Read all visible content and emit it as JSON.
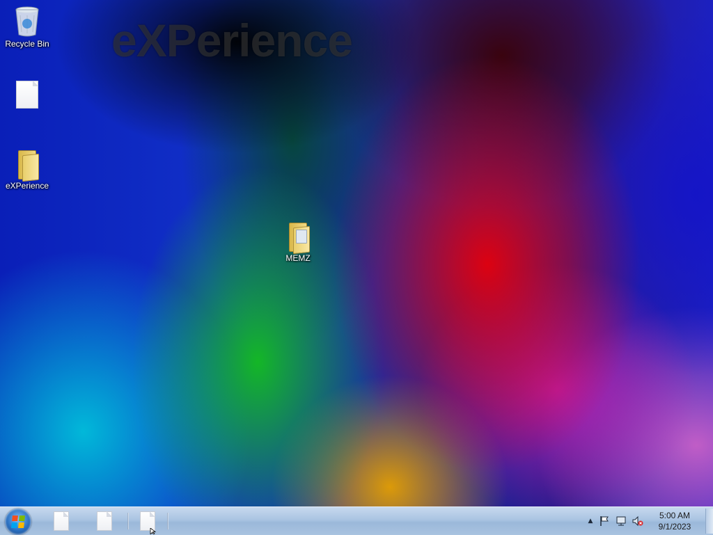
{
  "desktop": {
    "watermark": "eXPerience",
    "icons": [
      {
        "label": "Recycle Bin",
        "icon": "recycle-bin-icon"
      },
      {
        "label": "",
        "icon": "blank-document-icon"
      },
      {
        "label": "eXPerience",
        "icon": "folder-icon"
      },
      {
        "label": "MEMZ",
        "icon": "folder-icon"
      }
    ]
  },
  "taskbar": {
    "start": {
      "icon": "windows-start-icon"
    },
    "pinned": [
      {
        "icon": "blank-document-icon"
      },
      {
        "icon": "blank-document-icon"
      },
      {
        "icon": "blank-document-icon"
      }
    ],
    "tray": {
      "icons": [
        "show-hidden-icons-arrow-icon",
        "action-center-flag-icon",
        "network-icon",
        "volume-muted-icon"
      ],
      "time": "5:00 AM",
      "date": "9/1/2023"
    }
  },
  "colors": {
    "taskbar": "#a9c3e0",
    "label_text": "#ffffff"
  }
}
